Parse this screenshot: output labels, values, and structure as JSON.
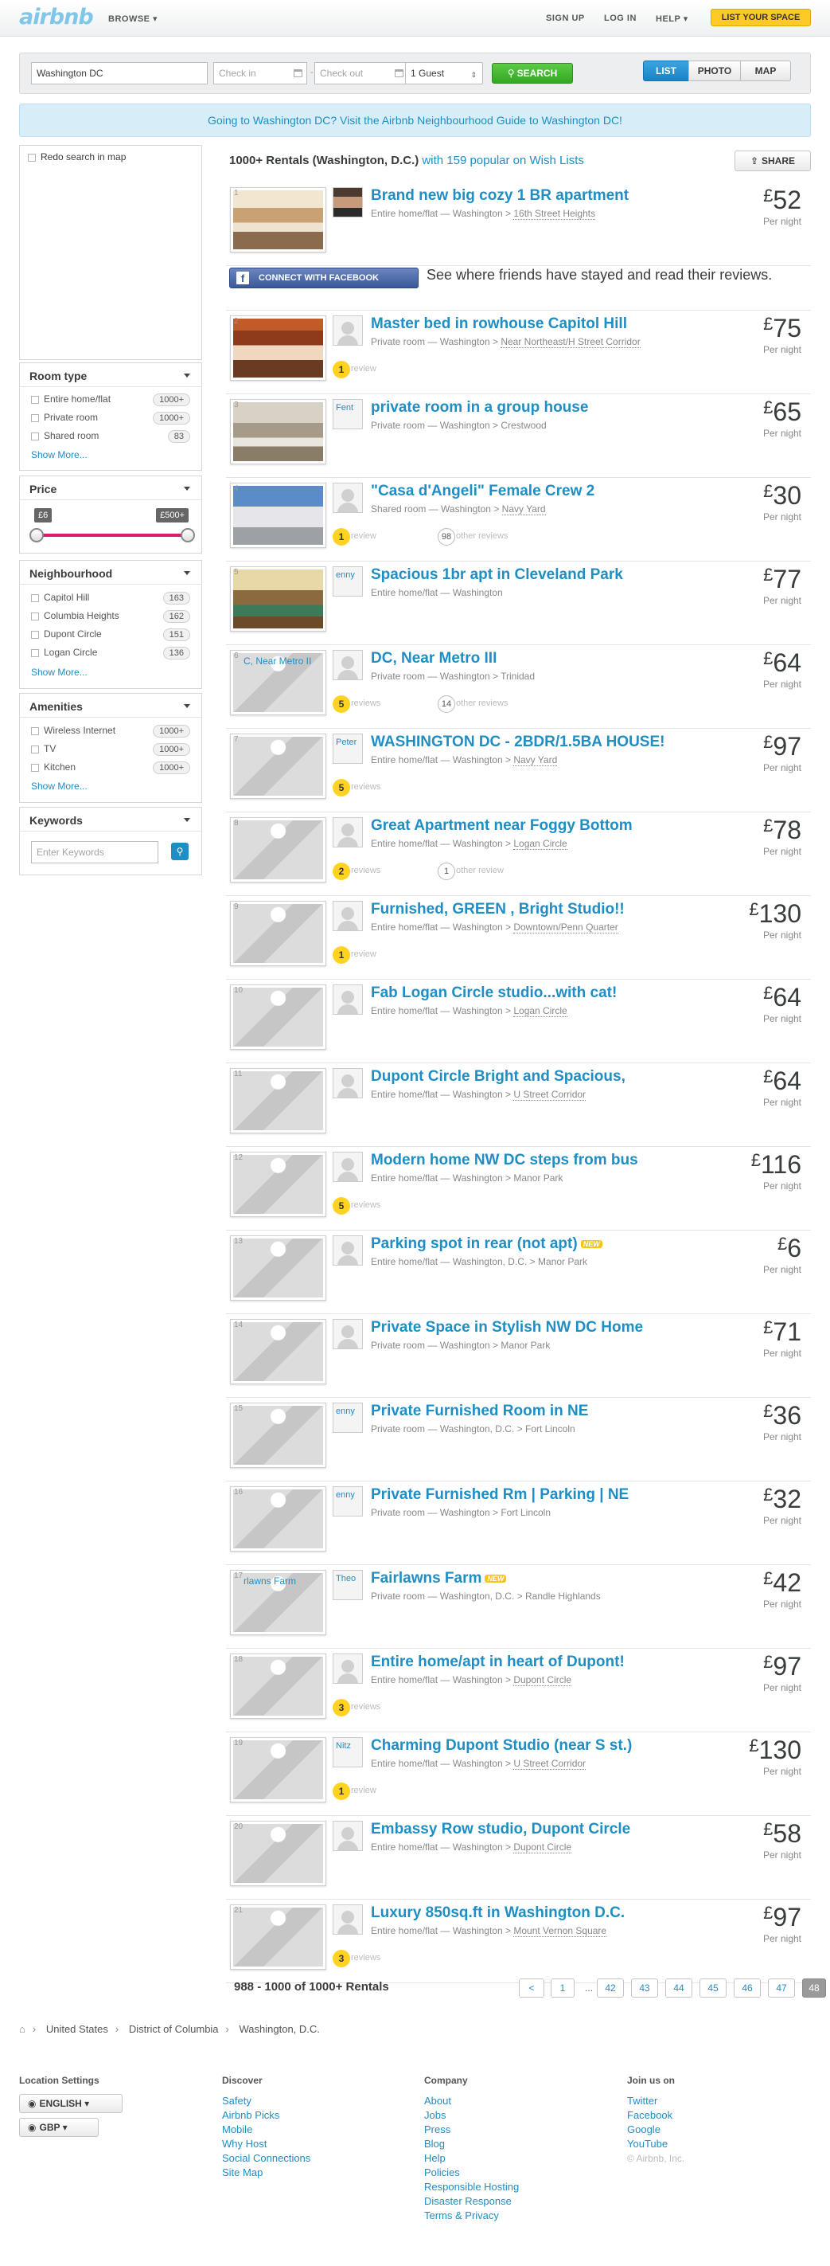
{
  "topbar": {
    "logo": "airbnb",
    "browse": "BROWSE ▾",
    "signup": "SIGN UP",
    "login": "LOG IN",
    "help": "HELP ▾",
    "list_space": "LIST YOUR SPACE"
  },
  "search": {
    "location": "Washington DC",
    "checkin_placeholder": "Check in",
    "checkout_placeholder": "Check out",
    "guests": "1 Guest",
    "button": "SEARCH",
    "views": [
      "LIST",
      "PHOTO",
      "MAP"
    ]
  },
  "banner": "Going to Washington DC? Visit the Airbnb Neighbourhood Guide to Washington DC!",
  "sidebar": {
    "redo": "Redo search in map",
    "room_type": {
      "title": "Room type",
      "items": [
        {
          "label": "Entire home/flat",
          "count": "1000+"
        },
        {
          "label": "Private room",
          "count": "1000+"
        },
        {
          "label": "Shared room",
          "count": "83"
        }
      ],
      "show_more": "Show More..."
    },
    "price": {
      "title": "Price",
      "min": "£6",
      "max": "£500+"
    },
    "neighbourhood": {
      "title": "Neighbourhood",
      "items": [
        {
          "label": "Capitol Hill",
          "count": "163"
        },
        {
          "label": "Columbia Heights",
          "count": "162"
        },
        {
          "label": "Dupont Circle",
          "count": "151"
        },
        {
          "label": "Logan Circle",
          "count": "136"
        }
      ],
      "show_more": "Show More..."
    },
    "amenities": {
      "title": "Amenities",
      "items": [
        {
          "label": "Wireless Internet",
          "count": "1000+"
        },
        {
          "label": "TV",
          "count": "1000+"
        },
        {
          "label": "Kitchen",
          "count": "1000+"
        }
      ],
      "show_more": "Show More..."
    },
    "keywords": {
      "title": "Keywords",
      "placeholder": "Enter Keywords"
    }
  },
  "results": {
    "count": "1000+ Rentals (Washington, D.C.)",
    "wishlist": "with 159 popular on Wish Lists",
    "share": "SHARE"
  },
  "facebook": {
    "button": "CONNECT WITH FACEBOOK",
    "text": "See where friends have stayed and read their reviews."
  },
  "listings": [
    {
      "num": "1",
      "title": "Brand new big cozy 1 BR apartment",
      "type": "Entire home/flat",
      "city": "Washington",
      "area": "16th Street Heights",
      "area_link": true,
      "price": "52",
      "pernight": "Per night",
      "photo": "kitchen",
      "host": "photo",
      "host_name": ""
    },
    {
      "num": "2",
      "title": "Master bed in rowhouse Capitol Hill",
      "type": "Private room",
      "city": "Washington",
      "area": "Near Northeast/H Street Corridor",
      "area_link": true,
      "price": "75",
      "pernight": "Per night",
      "photo": "bedroom",
      "host": "",
      "host_name": "",
      "reviews": "1",
      "reviews_text": "review"
    },
    {
      "num": "3",
      "title": "private room in a group house",
      "type": "Private room",
      "city": "Washington",
      "area": "Crestwood",
      "area_link": false,
      "price": "65",
      "pernight": "Per night",
      "photo": "room",
      "host": "name",
      "host_name": "Fent"
    },
    {
      "num": "4",
      "title": "\"Casa d'Angeli\" Female Crew 2",
      "type": "Shared room",
      "city": "Washington",
      "area": "Navy Yard",
      "area_link": true,
      "price": "30",
      "pernight": "Per night",
      "photo": "capitol",
      "host": "",
      "host_name": "",
      "reviews": "1",
      "reviews_text": "review",
      "others": "98",
      "others_text": "other reviews"
    },
    {
      "num": "5",
      "title": "Spacious 1br apt in Cleveland Park",
      "type": "Entire home/flat",
      "city": "Washington",
      "area": "",
      "area_link": false,
      "price": "77",
      "pernight": "Per night",
      "photo": "living",
      "host": "name",
      "host_name": "enny"
    },
    {
      "num": "6",
      "title": "DC, Near Metro III",
      "type": "Private room",
      "city": "Washington",
      "area": "Trinidad",
      "area_link": false,
      "price": "64",
      "pernight": "Per night",
      "photo": "",
      "caption": "C, Near Metro II",
      "host": "",
      "host_name": "",
      "reviews": "5",
      "reviews_text": "reviews",
      "others": "14",
      "others_text": "other reviews"
    },
    {
      "num": "7",
      "title": "WASHINGTON DC - 2BDR/1.5BA HOUSE!",
      "type": "Entire home/flat",
      "city": "Washington",
      "area": "Navy Yard",
      "area_link": true,
      "price": "97",
      "pernight": "Per night",
      "photo": "",
      "host": "name",
      "host_name": "Peter",
      "reviews": "5",
      "reviews_text": "reviews"
    },
    {
      "num": "8",
      "title": "Great Apartment near Foggy Bottom",
      "type": "Entire home/flat",
      "city": "Washington",
      "area": "Logan Circle",
      "area_link": true,
      "price": "78",
      "pernight": "Per night",
      "photo": "",
      "host": "",
      "host_name": "",
      "reviews": "2",
      "reviews_text": "reviews",
      "others": "1",
      "others_text": "other review"
    },
    {
      "num": "9",
      "title": "Furnished, GREEN , Bright Studio!!",
      "type": "Entire home/flat",
      "city": "Washington",
      "area": "Downtown/Penn Quarter",
      "area_link": true,
      "price": "130",
      "pernight": "Per night",
      "photo": "",
      "host": "",
      "host_name": "",
      "reviews": "1",
      "reviews_text": "review"
    },
    {
      "num": "10",
      "title": "Fab Logan Circle studio...with cat!",
      "type": "Entire home/flat",
      "city": "Washington",
      "area": "Logan Circle",
      "area_link": true,
      "price": "64",
      "pernight": "Per night",
      "photo": "",
      "host": "",
      "host_name": ""
    },
    {
      "num": "11",
      "title": "Dupont Circle Bright and Spacious,",
      "type": "Entire home/flat",
      "city": "Washington",
      "area": "U Street Corridor",
      "area_link": true,
      "price": "64",
      "pernight": "Per night",
      "photo": "",
      "host": "",
      "host_name": ""
    },
    {
      "num": "12",
      "title": "Modern home NW DC steps from bus",
      "type": "Entire home/flat",
      "city": "Washington",
      "area": "Manor Park",
      "area_link": false,
      "price": "116",
      "pernight": "Per night",
      "photo": "",
      "host": "",
      "host_name": "",
      "reviews": "5",
      "reviews_text": "reviews"
    },
    {
      "num": "13",
      "title": "Parking spot in rear (not apt)",
      "new": "NEW",
      "type": "Entire home/flat",
      "city": "Washington, D.C.",
      "area": "Manor Park",
      "area_link": false,
      "price": "6",
      "pernight": "Per night",
      "photo": "",
      "host": "",
      "host_name": ""
    },
    {
      "num": "14",
      "title": "Private Space in Stylish NW DC Home",
      "type": "Private room",
      "city": "Washington",
      "area": "Manor Park",
      "area_link": false,
      "price": "71",
      "pernight": "Per night",
      "photo": "",
      "host": "",
      "host_name": ""
    },
    {
      "num": "15",
      "title": "Private Furnished Room in NE",
      "type": "Private room",
      "city": "Washington, D.C.",
      "area": "Fort Lincoln",
      "area_link": false,
      "price": "36",
      "pernight": "Per night",
      "photo": "",
      "host": "name",
      "host_name": "enny"
    },
    {
      "num": "16",
      "title": "Private Furnished Rm | Parking | NE",
      "type": "Private room",
      "city": "Washington",
      "area": "Fort Lincoln",
      "area_link": false,
      "price": "32",
      "pernight": "Per night",
      "photo": "",
      "host": "name",
      "host_name": "enny"
    },
    {
      "num": "17",
      "title": "Fairlawns Farm",
      "new": "NEW",
      "type": "Private room",
      "city": "Washington, D.C.",
      "area": "Randle Highlands",
      "area_link": false,
      "price": "42",
      "pernight": "Per night",
      "photo": "",
      "caption": "rlawns Farm",
      "host": "name",
      "host_name": "Theo"
    },
    {
      "num": "18",
      "title": "Entire home/apt in heart of Dupont!",
      "type": "Entire home/flat",
      "city": "Washington",
      "area": "Dupont Circle",
      "area_link": true,
      "price": "97",
      "pernight": "Per night",
      "photo": "",
      "host": "",
      "host_name": "",
      "reviews": "3",
      "reviews_text": "reviews"
    },
    {
      "num": "19",
      "title": "Charming Dupont Studio (near S st.)",
      "type": "Entire home/flat",
      "city": "Washington",
      "area": "U Street Corridor",
      "area_link": true,
      "price": "130",
      "pernight": "Per night",
      "photo": "",
      "host": "name",
      "host_name": "Nitz",
      "reviews": "1",
      "reviews_text": "review"
    },
    {
      "num": "20",
      "title": "Embassy Row studio, Dupont Circle",
      "type": "Entire home/flat",
      "city": "Washington",
      "area": "Dupont Circle",
      "area_link": true,
      "price": "58",
      "pernight": "Per night",
      "photo": "",
      "host": "",
      "host_name": ""
    },
    {
      "num": "21",
      "title": "Luxury 850sq.ft in Washington D.C.",
      "type": "Entire home/flat",
      "city": "Washington",
      "area": "Mount Vernon Square",
      "area_link": true,
      "price": "97",
      "pernight": "Per night",
      "photo": "",
      "host": "",
      "host_name": "",
      "reviews": "3",
      "reviews_text": "reviews"
    }
  ],
  "currency_symbol": "£",
  "pagination": {
    "summary": "988 - 1000 of 1000+ Rentals",
    "pages": [
      "<",
      "1",
      "...",
      "42",
      "43",
      "44",
      "45",
      "46",
      "47",
      "48"
    ],
    "current": "48"
  },
  "breadcrumb": [
    "United States",
    "District of Columbia",
    "Washington, D.C."
  ],
  "footer": {
    "settings": {
      "title": "Location Settings",
      "language": "ENGLISH ▾",
      "currency": "GBP ▾"
    },
    "discover": {
      "title": "Discover",
      "links": [
        "Safety",
        "Airbnb Picks",
        "Mobile",
        "Why Host",
        "Social Connections",
        "Site Map"
      ]
    },
    "company": {
      "title": "Company",
      "links": [
        "About",
        "Jobs",
        "Press",
        "Blog",
        "Help",
        "Policies",
        "Responsible Hosting",
        "Disaster Response",
        "Terms & Privacy"
      ]
    },
    "joinus": {
      "title": "Join us on",
      "links": [
        "Twitter",
        "Facebook",
        "Google",
        "YouTube"
      ],
      "copyright": "© Airbnb, Inc."
    }
  },
  "colors": {
    "accent": "#1e8ec4",
    "search_green": "#3fb62e",
    "list_yellow": "#ffca28",
    "slider_pink": "#dd1a6e",
    "facebook_blue": "#3b5998",
    "review_yellow": "#ffd31f"
  }
}
